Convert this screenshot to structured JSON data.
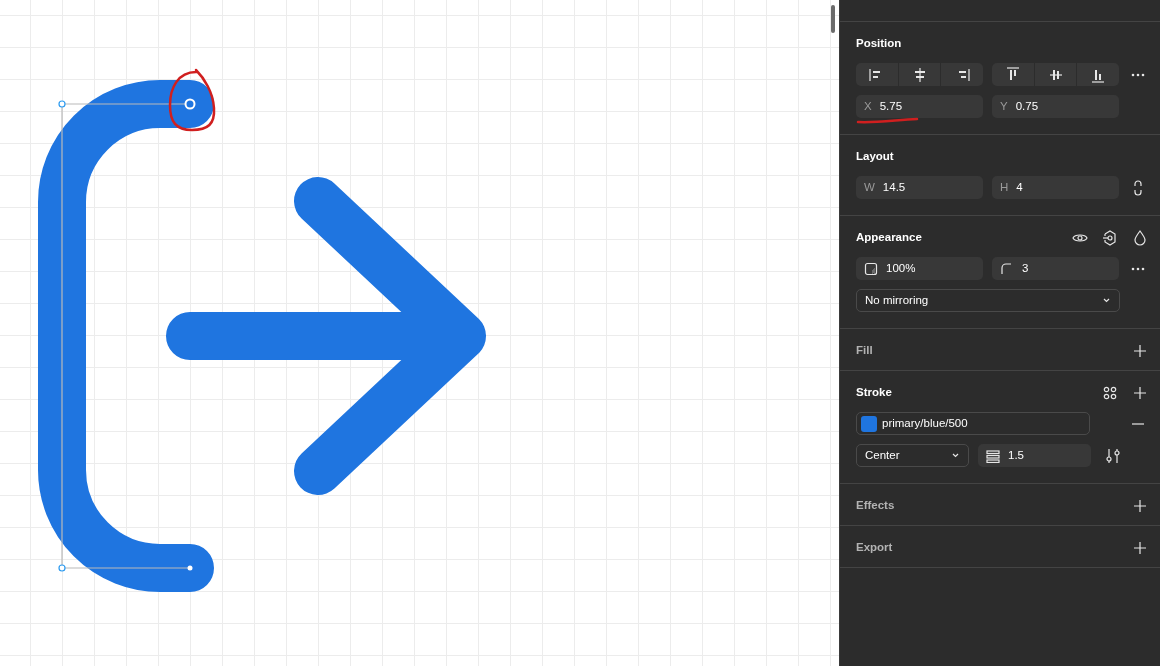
{
  "panel": {
    "sections": [
      {
        "kind": "position",
        "title": "Position",
        "fields": [
          {
            "label": "X",
            "value": "5.75"
          },
          {
            "label": "Y",
            "value": "0.75"
          }
        ]
      },
      {
        "kind": "layout",
        "title": "Layout",
        "fields": [
          {
            "label": "W",
            "value": "14.5"
          },
          {
            "label": "H",
            "value": "4"
          }
        ]
      },
      {
        "kind": "appearance",
        "title": "Appearance",
        "fields": [
          {
            "value": "100%"
          },
          {
            "value": "3"
          }
        ],
        "mirroring": "No mirroring"
      },
      {
        "kind": "empty",
        "title": "Fill"
      },
      {
        "kind": "stroke",
        "title": "Stroke",
        "paint": {
          "name": "primary/blue/500",
          "color": "#1f75e0"
        },
        "position": "Center",
        "weight": "1.5"
      },
      {
        "kind": "empty",
        "title": "Effects"
      },
      {
        "kind": "empty",
        "title": "Export"
      }
    ]
  }
}
